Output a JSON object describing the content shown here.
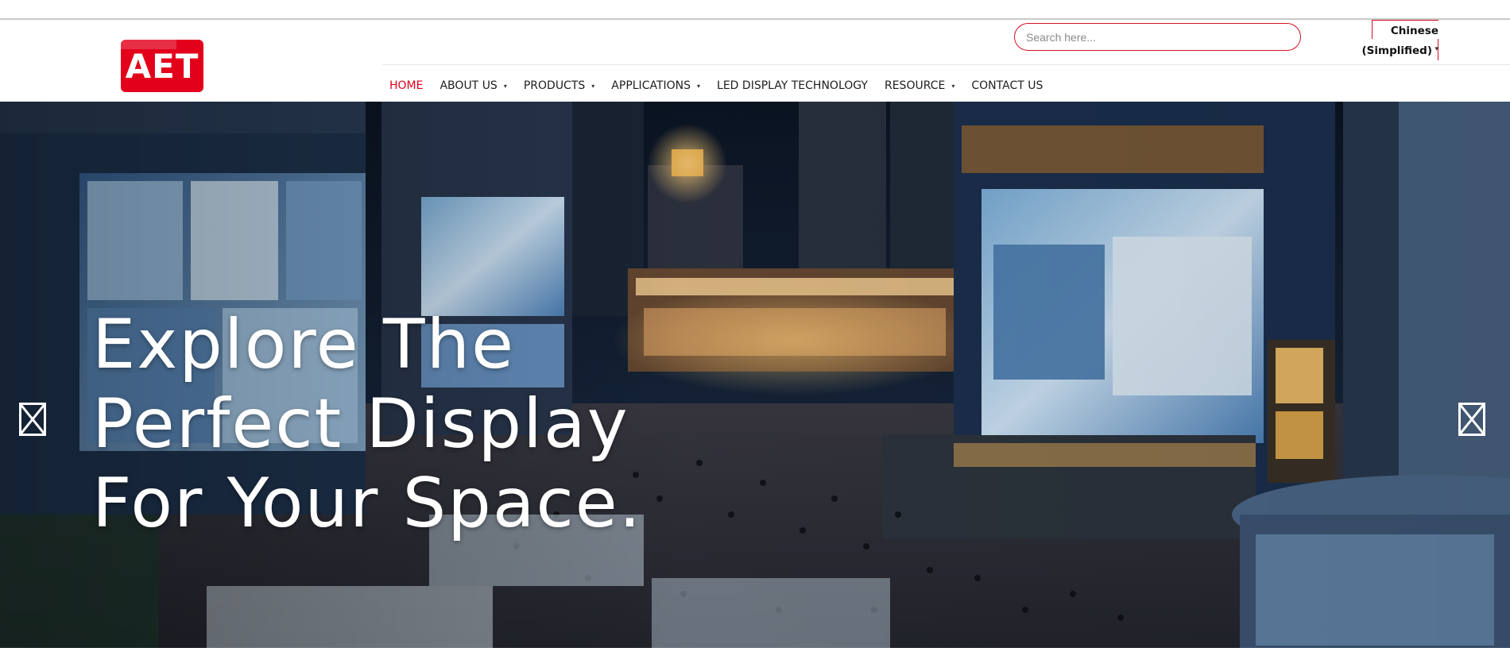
{
  "brand": {
    "logo_text": "AET",
    "accent": "#e3001b"
  },
  "search": {
    "placeholder": "Search here...",
    "value": ""
  },
  "language": {
    "line1": "Chinese",
    "line2": "(Simplified)",
    "caret": "▾"
  },
  "nav": {
    "items": [
      {
        "label": "HOME",
        "dropdown": false,
        "active": true
      },
      {
        "label": "ABOUT US",
        "dropdown": true,
        "active": false
      },
      {
        "label": "PRODUCTS",
        "dropdown": true,
        "active": false
      },
      {
        "label": "APPLICATIONS",
        "dropdown": true,
        "active": false
      },
      {
        "label": "LED DISPLAY TECHNOLOGY",
        "dropdown": false,
        "active": false
      },
      {
        "label": "RESOURCE",
        "dropdown": true,
        "active": false
      },
      {
        "label": "CONTACT US",
        "dropdown": false,
        "active": false
      }
    ],
    "caret": "▾"
  },
  "hero": {
    "headline": [
      "Explore The",
      "Perfect Display",
      "For Your Space."
    ],
    "prev_icon": "broken-image-arrow-icon",
    "next_icon": "broken-image-arrow-icon"
  }
}
